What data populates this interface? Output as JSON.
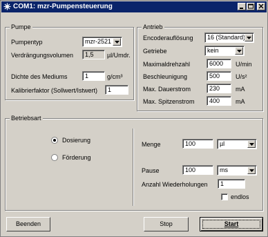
{
  "window": {
    "title": "COM1: mzr-Pumpensteuerung",
    "min_icon": "minimize-icon",
    "max_icon": "maximize-icon",
    "close_icon": "close-icon"
  },
  "pumpe": {
    "title": "Pumpe",
    "pumpentyp_label": "Pumpentyp",
    "pumpentyp_value": "mzr-2521",
    "verdraengung_label": "Verdrängungsvolumen",
    "verdraengung_value": "1,5",
    "verdraengung_unit": "µl/Umdr.",
    "dichte_label": "Dichte des Mediums",
    "dichte_value": "1",
    "dichte_unit": "g/cm³",
    "kalibrier_label": "Kalibrierfaktor (Sollwert/Istwert)",
    "kalibrier_value": "1"
  },
  "antrieb": {
    "title": "Antrieb",
    "encoder_label": "Encoderauflösung",
    "encoder_value": "16 (Standard)",
    "getriebe_label": "Getriebe",
    "getriebe_value": "kein",
    "maxdreh_label": "Maximaldrehzahl",
    "maxdreh_value": "6000",
    "maxdreh_unit": "U/min",
    "beschl_label": "Beschleunigung",
    "beschl_value": "500",
    "beschl_unit": "U/s²",
    "dauer_label": "Max. Dauerstrom",
    "dauer_value": "230",
    "dauer_unit": "mA",
    "spitzen_label": "Max. Spitzenstrom",
    "spitzen_value": "400",
    "spitzen_unit": "mA"
  },
  "betriebsart": {
    "title": "Betriebsart",
    "dosierung_label": "Dosierung",
    "foerderung_label": "Förderung",
    "selected": "Dosierung",
    "menge_label": "Menge",
    "menge_value": "100",
    "menge_unit": "µl",
    "pause_label": "Pause",
    "pause_value": "100",
    "pause_unit": "ms",
    "wdh_label": "Anzahl Wiederholungen",
    "wdh_value": "1",
    "endlos_label": "endlos"
  },
  "buttons": {
    "beenden": "Beenden",
    "stop": "Stop",
    "start": "Start"
  }
}
